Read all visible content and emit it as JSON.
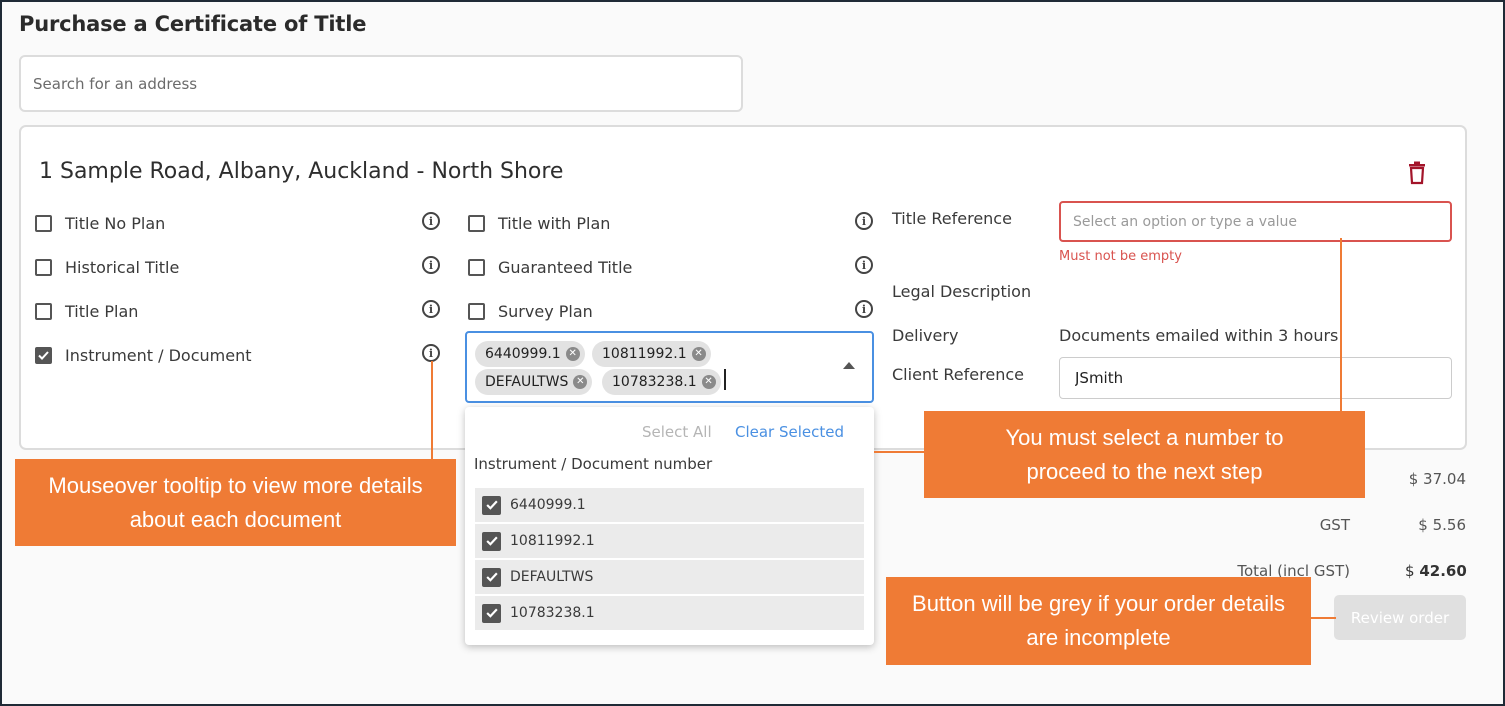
{
  "page": {
    "title": "Purchase a Certificate of Title"
  },
  "search": {
    "placeholder": "Search for an address"
  },
  "property": {
    "address": "1 Sample Road, Albany, Auckland - North Shore",
    "products_left": [
      {
        "label": "Title No Plan",
        "checked": false
      },
      {
        "label": "Historical Title",
        "checked": false
      },
      {
        "label": "Title Plan",
        "checked": false
      },
      {
        "label": "Instrument / Document",
        "checked": true
      }
    ],
    "products_right": [
      {
        "label": "Title with Plan",
        "checked": false
      },
      {
        "label": "Guaranteed Title",
        "checked": false
      },
      {
        "label": "Survey Plan",
        "checked": false
      }
    ],
    "chips": [
      "6440999.1",
      "10811992.1",
      "DEFAULTWS",
      "10783238.1"
    ],
    "dropdown": {
      "select_all": "Select All",
      "clear_selected": "Clear Selected",
      "heading": "Instrument / Document number",
      "items": [
        "6440999.1",
        "10811992.1",
        "DEFAULTWS",
        "10783238.1"
      ]
    },
    "details": {
      "title_reference_label": "Title Reference",
      "title_reference_placeholder": "Select an option or type a value",
      "title_reference_error": "Must not be empty",
      "legal_description_label": "Legal Description",
      "delivery_label": "Delivery",
      "delivery_value": "Documents emailed within 3 hours",
      "client_reference_label": "Client Reference",
      "client_reference_value": "JSmith"
    }
  },
  "summary": {
    "subtotal": "$ 37.04",
    "gst_label": "GST",
    "gst": "$ 5.56",
    "total_label": "Total (incl GST)",
    "total_currency": "$",
    "total": "42.60",
    "review_button": "Review order"
  },
  "callouts": {
    "tooltip": "Mouseover tooltip to view more details about each document",
    "select_number": "You must select a number to proceed to the next step",
    "grey_button": "Button will be grey if your order details are incomplete"
  },
  "colors": {
    "accent_blue": "#4a90e2",
    "error_red": "#d9534f",
    "callout_orange": "#ef7b35",
    "trash_red": "#a3142a"
  }
}
